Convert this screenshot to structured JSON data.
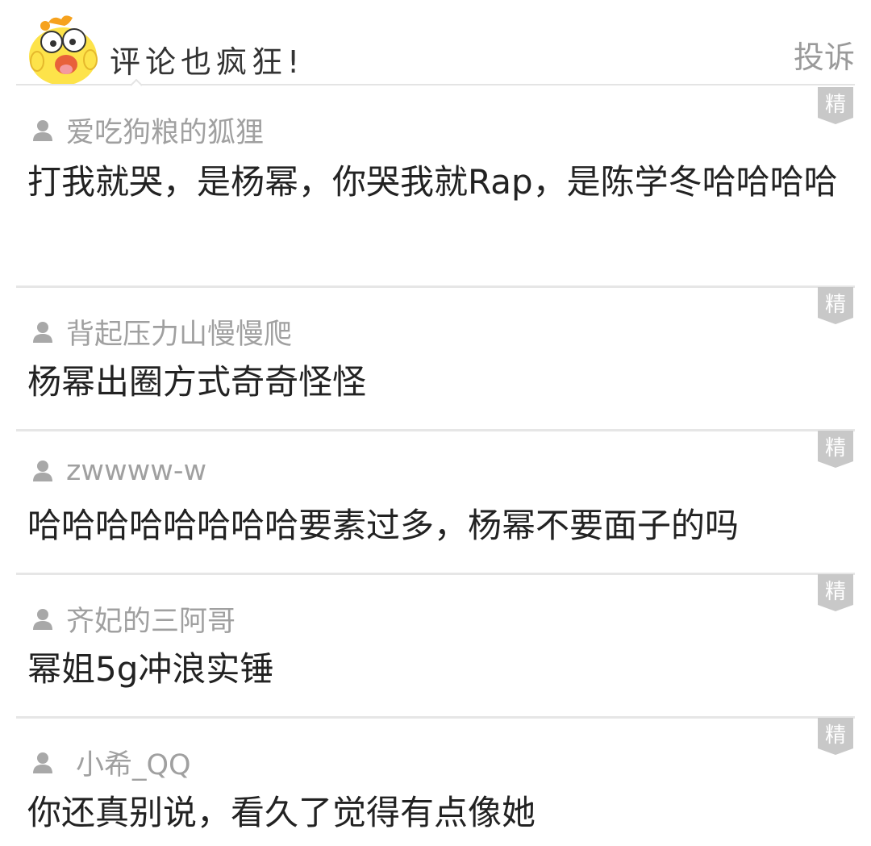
{
  "header": {
    "title": "评论也疯狂!",
    "report_label": "投诉"
  },
  "badge_label": "精",
  "comments": [
    {
      "username": "爱吃狗粮的狐狸",
      "text": "打我就哭，是杨幂，你哭我就Rap，是陈学冬哈哈哈哈"
    },
    {
      "username": "背起压力山慢慢爬",
      "text": "杨幂出圈方式奇奇怪怪"
    },
    {
      "username": "zwwww-w",
      "text": "哈哈哈哈哈哈哈哈要素过多，杨幂不要面子的吗"
    },
    {
      "username": "齐妃的三阿哥",
      "text": "幂姐5g冲浪实锤"
    },
    {
      "username": "小希_QQ",
      "text": "你还真别说，看久了觉得有点像她"
    }
  ],
  "colors": {
    "username": "#a0a0a0",
    "comment_text": "#222222",
    "badge": "#c8c8c8",
    "separator": "#e6e6e6"
  }
}
